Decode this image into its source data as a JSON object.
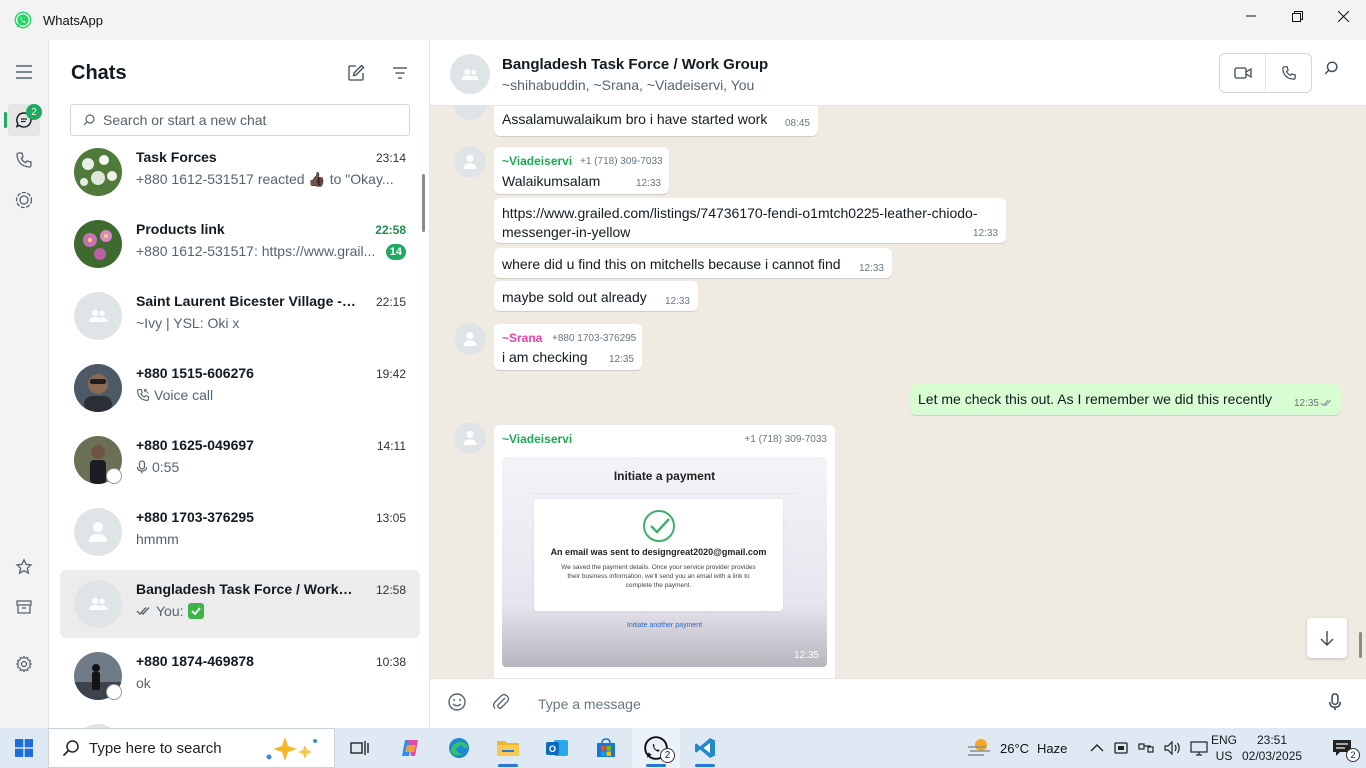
{
  "window": {
    "title": "WhatsApp"
  },
  "rail": {
    "chats_badge": "2"
  },
  "chatlist": {
    "title": "Chats",
    "search_placeholder": "Search or start a new chat",
    "chats": [
      {
        "name": "Task Forces",
        "time": "23:14",
        "preview": "+880 1612-531517 reacted 👍🏿 to \"Okay...",
        "unread": ""
      },
      {
        "name": "Products link",
        "time": "22:58",
        "preview": "+880 1612-531517: https://www.grail...",
        "unread": "14"
      },
      {
        "name": "Saint Laurent Bicester Village  - I...",
        "time": "22:15",
        "preview": "~Ivy | YSL: Oki x",
        "unread": ""
      },
      {
        "name": "+880 1515-606276",
        "time": "19:42",
        "preview": "Voice call",
        "unread": ""
      },
      {
        "name": "+880 1625-049697",
        "time": "14:11",
        "preview": "0:55",
        "unread": ""
      },
      {
        "name": "+880 1703-376295",
        "time": "13:05",
        "preview": "hmmm",
        "unread": ""
      },
      {
        "name": "Bangladesh Task Force / Work Gr...",
        "time": "12:58",
        "preview": "You:",
        "unread": ""
      },
      {
        "name": "+880 1874-469878",
        "time": "10:38",
        "preview": "ok",
        "unread": ""
      }
    ]
  },
  "conversation": {
    "title": "Bangladesh Task Force / Work Group",
    "members": "~shihabuddin, ~Srana, ~Viadeiservi, You",
    "messages": [
      {
        "text": "Assalamuwalaikum bro i have started work",
        "time": "08:45"
      },
      {
        "sender": "~Viadeiservi",
        "phone": "+1 (718) 309-7033",
        "text": "Walaikumsalam",
        "time": "12:33"
      },
      {
        "text_line1": "https://www.grailed.com/listings/74736170-fendi-o1mtch0225-leather-chiodo-",
        "text_line2": "messenger-in-yellow",
        "time": "12:33"
      },
      {
        "text": "where did u find this on mitchells because i cannot find",
        "time": "12:33"
      },
      {
        "text": "maybe sold out already",
        "time": "12:33"
      },
      {
        "sender": "~Srana",
        "phone": "+880 1703-376295",
        "text": "i am checking",
        "time": "12:35"
      },
      {
        "text": "Let me check this out. As I remember we did this recently",
        "time": "12:35"
      },
      {
        "sender": "~Viadeiservi",
        "phone": "+1 (718) 309-7033",
        "time": "12:35",
        "image": {
          "heading": "Initiate a payment",
          "line1": "An email was sent to designgreat2020@gmail.com",
          "line2": "We saved the payment details. Once your service provider provides their business information, we'll send you an email with a link to complete the payment.",
          "link": "Initiate another payment"
        }
      }
    ],
    "composer_placeholder": "Type a message"
  },
  "taskbar": {
    "search_placeholder": "Type here to search",
    "whatsapp_badge": "2",
    "weather_temp": "26°C",
    "weather_desc": "Haze",
    "lang_line1": "ENG",
    "lang_line2": "US",
    "time": "23:51",
    "date": "02/03/2025",
    "notif_count": "2"
  },
  "colors": {
    "accent": "#1daa61",
    "outgoing_bubble": "#d9fdd3",
    "chat_bg": "#efeae2",
    "viadeiservi": "#1fa855",
    "srana": "#e542a3"
  }
}
